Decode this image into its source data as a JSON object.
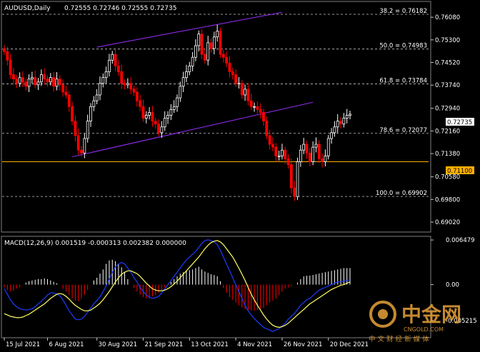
{
  "header": {
    "symbol_tf": "AUDUSD,Daily",
    "ohlc": "0.72555 0.72746 0.72555 0.72735"
  },
  "macd_header": "MACD(12,26,9) 0.001519 -0.000313 0.002382 0.000000",
  "price_axis": {
    "ticks": [
      "0.76080",
      "0.75300",
      "0.74520",
      "0.73740",
      "0.72940",
      "0.72160",
      "0.71380",
      "0.70580",
      "0.69800",
      "0.69020"
    ],
    "current_price": "0.72735",
    "hline_price": "0.71100"
  },
  "macd_axis": {
    "ticks": [
      "0.006479",
      "0.00",
      "-0.005215"
    ]
  },
  "fibonacci": [
    {
      "label": "38.2 = 0.76182",
      "price": 0.76182
    },
    {
      "label": "50.0 = 0.74983",
      "price": 0.74983
    },
    {
      "label": "61.8 = 0.73784",
      "price": 0.73784
    },
    {
      "label": "78.6 = 0.72077",
      "price": 0.72077
    },
    {
      "label": "100.0 = 0.69902",
      "price": 0.69902
    }
  ],
  "date_axis": [
    "15 Jul 2021",
    "6 Aug 2021",
    "30 Aug 2021",
    "21 Sep 2021",
    "13 Oct 2021",
    "4 Nov 2021",
    "26 Nov 2021",
    "20 Dec 2021"
  ],
  "watermark": {
    "brand": "中金网",
    "site": "CNGOLD.COM",
    "slogan": "中 文 财 经 新 媒 体"
  },
  "colors": {
    "bull": "#ffffff",
    "bear": "#ff0000",
    "channel": "#9b30ff",
    "hline": "#ffb000",
    "macd_line": "#1e3cff",
    "signal_line": "#ffff66",
    "grid": "#c8c8c8",
    "watermark": "#e8a23a"
  },
  "chart_data": {
    "type": "candlestick",
    "closes": [
      0.749,
      0.746,
      0.741,
      0.7395,
      0.738,
      0.74,
      0.7385,
      0.737,
      0.7395,
      0.74,
      0.7375,
      0.7385,
      0.741,
      0.7395,
      0.7385,
      0.74,
      0.737,
      0.7395,
      0.7375,
      0.735,
      0.734,
      0.73,
      0.725,
      0.72,
      0.715,
      0.714,
      0.719,
      0.725,
      0.73,
      0.732,
      0.734,
      0.738,
      0.74,
      0.742,
      0.746,
      0.748,
      0.744,
      0.742,
      0.738,
      0.7375,
      0.738,
      0.736,
      0.735,
      0.732,
      0.73,
      0.726,
      0.727,
      0.728,
      0.725,
      0.724,
      0.721,
      0.723,
      0.726,
      0.727,
      0.729,
      0.73,
      0.733,
      0.737,
      0.74,
      0.742,
      0.744,
      0.747,
      0.751,
      0.755,
      0.748,
      0.746,
      0.752,
      0.75,
      0.754,
      0.756,
      0.748,
      0.747,
      0.745,
      0.742,
      0.741,
      0.738,
      0.738,
      0.734,
      0.736,
      0.732,
      0.73,
      0.73,
      0.729,
      0.728,
      0.725,
      0.72,
      0.717,
      0.716,
      0.713,
      0.713,
      0.715,
      0.712,
      0.71,
      0.702,
      0.699,
      0.711,
      0.715,
      0.717,
      0.714,
      0.711,
      0.716,
      0.717,
      0.712,
      0.711,
      0.713,
      0.719,
      0.721,
      0.723,
      0.725,
      0.724,
      0.726,
      0.727,
      0.7274
    ],
    "ylim": [
      0.687,
      0.766
    ],
    "macd_hist": [
      -0.0004,
      -0.0008,
      -0.001,
      -0.0009,
      -0.0006,
      -0.0004,
      0.0,
      0.0003,
      0.0005,
      0.0006,
      0.0007,
      0.0008,
      0.0008,
      0.0009,
      0.0008,
      0.0006,
      0.0004,
      0.0002,
      0.0,
      -0.0006,
      -0.001,
      -0.0015,
      -0.002,
      -0.0023,
      -0.0024,
      -0.002,
      -0.0015,
      -0.0008,
      0.0,
      0.0006,
      0.001,
      0.0016,
      0.0022,
      0.003,
      0.0035,
      0.0036,
      0.0034,
      0.003,
      0.0025,
      0.0018,
      0.0008,
      0.0,
      -0.0005,
      -0.001,
      -0.0015,
      -0.0018,
      -0.002,
      -0.002,
      -0.0017,
      -0.0015,
      -0.0012,
      -0.0008,
      -0.0004,
      0.0,
      0.0004,
      0.0008,
      0.0012,
      0.0016,
      0.0018,
      0.002,
      0.0021,
      0.0022,
      0.0024,
      0.0026,
      0.0022,
      0.0019,
      0.0017,
      0.0015,
      0.0014,
      0.0012,
      0.0005,
      -0.0005,
      -0.0012,
      -0.0018,
      -0.0022,
      -0.0026,
      -0.003,
      -0.0033,
      -0.0036,
      -0.0037,
      -0.0038,
      -0.0038,
      -0.0037,
      -0.0035,
      -0.0034,
      -0.003,
      -0.0026,
      -0.0023,
      -0.002,
      -0.0015,
      -0.001,
      -0.0006,
      -0.0004,
      -0.0002,
      0.0,
      0.0003,
      0.0008,
      0.0012,
      0.0013,
      0.0013,
      0.0014,
      0.0015,
      0.0016,
      0.0017,
      0.0018,
      0.0019,
      0.002,
      0.0021,
      0.0022,
      0.0023,
      0.0024,
      0.0024,
      0.0024
    ],
    "macd_line": [
      -0.0006,
      -0.0014,
      -0.0022,
      -0.0028,
      -0.0032,
      -0.0035,
      -0.0036,
      -0.0037,
      -0.0036,
      -0.0035,
      -0.0032,
      -0.0028,
      -0.0024,
      -0.002,
      -0.0015,
      -0.0012,
      -0.0012,
      -0.0014,
      -0.0016,
      -0.0022,
      -0.003,
      -0.0038,
      -0.0044,
      -0.005,
      -0.0051,
      -0.005,
      -0.0046,
      -0.004,
      -0.0034,
      -0.0028,
      -0.0023,
      -0.0018,
      -0.001,
      -0.0002,
      0.0008,
      0.0018,
      0.0026,
      0.003,
      0.0032,
      0.003,
      0.0024,
      0.0018,
      0.001,
      0.0004,
      -0.0004,
      -0.001,
      -0.0015,
      -0.0018,
      -0.002,
      -0.0019,
      -0.0017,
      -0.0012,
      -0.0006,
      0.0,
      0.0006,
      0.0012,
      0.0018,
      0.0024,
      0.003,
      0.0036,
      0.004,
      0.0044,
      0.0048,
      0.0054,
      0.006,
      0.0064,
      0.0065,
      0.0064,
      0.0062,
      0.0058,
      0.005,
      0.004,
      0.003,
      0.002,
      0.001,
      0.0,
      -0.001,
      -0.002,
      -0.003,
      -0.0038,
      -0.0044,
      -0.0049,
      -0.0054,
      -0.0058,
      -0.0062,
      -0.0064,
      -0.0066,
      -0.0068,
      -0.0066,
      -0.0064,
      -0.006,
      -0.0056,
      -0.005,
      -0.0046,
      -0.0042,
      -0.0036,
      -0.003,
      -0.0026,
      -0.0022,
      -0.002,
      -0.0016,
      -0.0012,
      -0.0008,
      -0.0006,
      -0.0004,
      -0.0002,
      0.0,
      0.0002,
      0.0004,
      0.0004,
      0.0005,
      0.0006,
      0.0007
    ],
    "signal_line": [
      -0.0042,
      -0.0044,
      -0.0046,
      -0.0047,
      -0.0048,
      -0.0048,
      -0.0047,
      -0.0045,
      -0.0043,
      -0.004,
      -0.0037,
      -0.0034,
      -0.0031,
      -0.0028,
      -0.0024,
      -0.002,
      -0.0017,
      -0.0014,
      -0.0013,
      -0.0014,
      -0.0017,
      -0.0021,
      -0.0026,
      -0.003,
      -0.0033,
      -0.0036,
      -0.0038,
      -0.0038,
      -0.0037,
      -0.0034,
      -0.0031,
      -0.0027,
      -0.0022,
      -0.0016,
      -0.001,
      -0.0003,
      0.0004,
      0.001,
      0.0015,
      0.0018,
      0.002,
      0.002,
      0.0018,
      0.0016,
      0.0012,
      0.0007,
      0.0002,
      -0.0002,
      -0.0006,
      -0.0008,
      -0.0009,
      -0.0009,
      -0.0008,
      -0.0006,
      -0.0003,
      0.0001,
      0.0005,
      0.001,
      0.0015,
      0.002,
      0.0025,
      0.003,
      0.0035,
      0.004,
      0.0046,
      0.0052,
      0.0057,
      0.0061,
      0.0063,
      0.0064,
      0.0062,
      0.0058,
      0.0052,
      0.0046,
      0.004,
      0.0032,
      0.0024,
      0.0015,
      0.0006,
      -0.0004,
      -0.0014,
      -0.0022,
      -0.003,
      -0.0037,
      -0.0044,
      -0.005,
      -0.0055,
      -0.0059,
      -0.0061,
      -0.0062,
      -0.0061,
      -0.0059,
      -0.0056,
      -0.0052,
      -0.0048,
      -0.0044,
      -0.004,
      -0.0036,
      -0.0032,
      -0.0028,
      -0.0025,
      -0.0022,
      -0.0019,
      -0.0016,
      -0.0013,
      -0.001,
      -0.0007,
      -0.0005,
      -0.0003,
      -0.0001,
      0.0,
      0.0002,
      0.0004
    ],
    "macd_ylim": [
      -0.0075,
      0.0068
    ]
  }
}
